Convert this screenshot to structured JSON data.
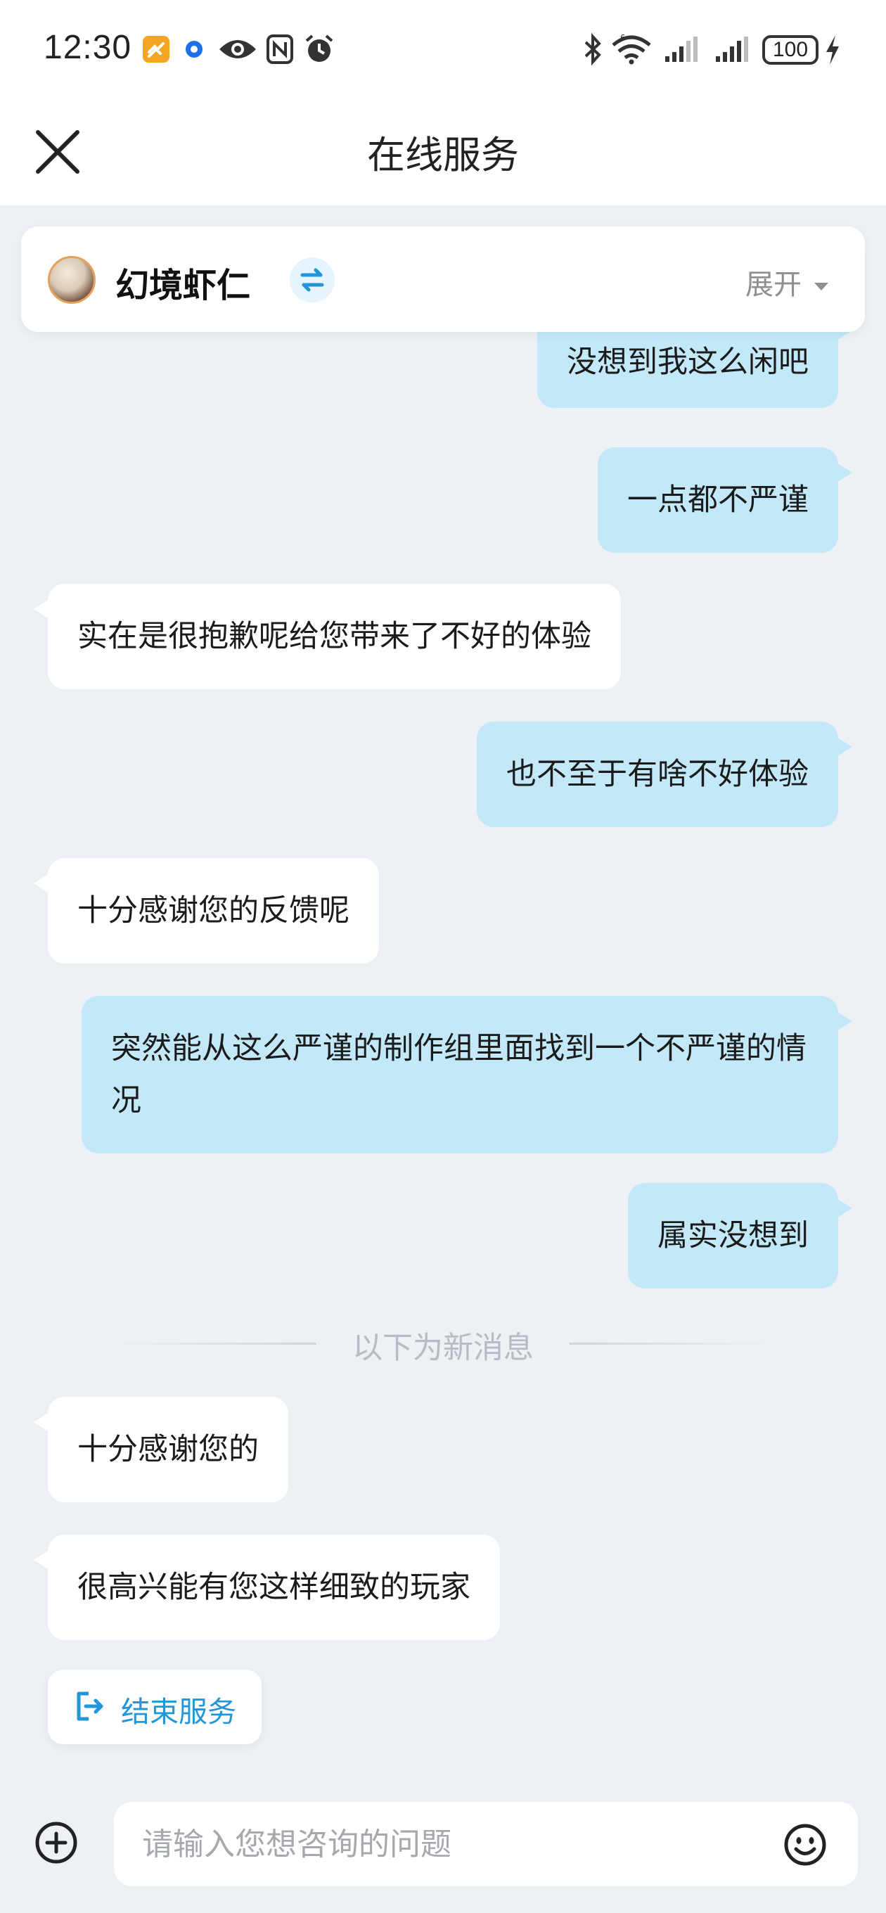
{
  "status_bar": {
    "time": "12:30",
    "battery": "100",
    "icons": [
      "app-notification-icon",
      "location-dot-icon",
      "eye-icon",
      "nfc-icon",
      "alarm-icon",
      "bluetooth-icon",
      "wifi-6-icon",
      "signal-icon",
      "signal-icon",
      "battery-icon",
      "charging-icon"
    ]
  },
  "header": {
    "title": "在线服务",
    "close_icon": "close-icon"
  },
  "agent_card": {
    "name": "幻境虾仁",
    "switch_icon": "swap-arrows-icon",
    "expand_label": "展开",
    "expand_icon": "caret-down-icon"
  },
  "messages": [
    {
      "from": "me",
      "text": "没想到我这么闲吧"
    },
    {
      "from": "me",
      "text": "一点都不严谨"
    },
    {
      "from": "agent",
      "text": "实在是很抱歉呢给您带来了不好的体验"
    },
    {
      "from": "me",
      "text": "也不至于有啥不好体验"
    },
    {
      "from": "agent",
      "text": "十分感谢您的反馈呢"
    },
    {
      "from": "me",
      "text": "突然能从这么严谨的制作组里面找到一个不严谨的情况"
    },
    {
      "from": "me",
      "text": "属实没想到"
    },
    {
      "from": "agent",
      "text": "十分感谢您的"
    },
    {
      "from": "agent",
      "text": "很高兴能有您这样细致的玩家"
    }
  ],
  "divider_text": "以下为新消息",
  "end_service": {
    "label": "结束服务",
    "icon": "exit-icon"
  },
  "composer": {
    "plus_icon": "add-circle-icon",
    "placeholder": "请输入您想咨询的问题",
    "value": "",
    "emoji_icon": "smiley-icon"
  },
  "colors": {
    "my_bubble": "#c3e9f9",
    "agent_bubble": "#ffffff",
    "background": "#edf1f5",
    "accent": "#2196d8"
  }
}
